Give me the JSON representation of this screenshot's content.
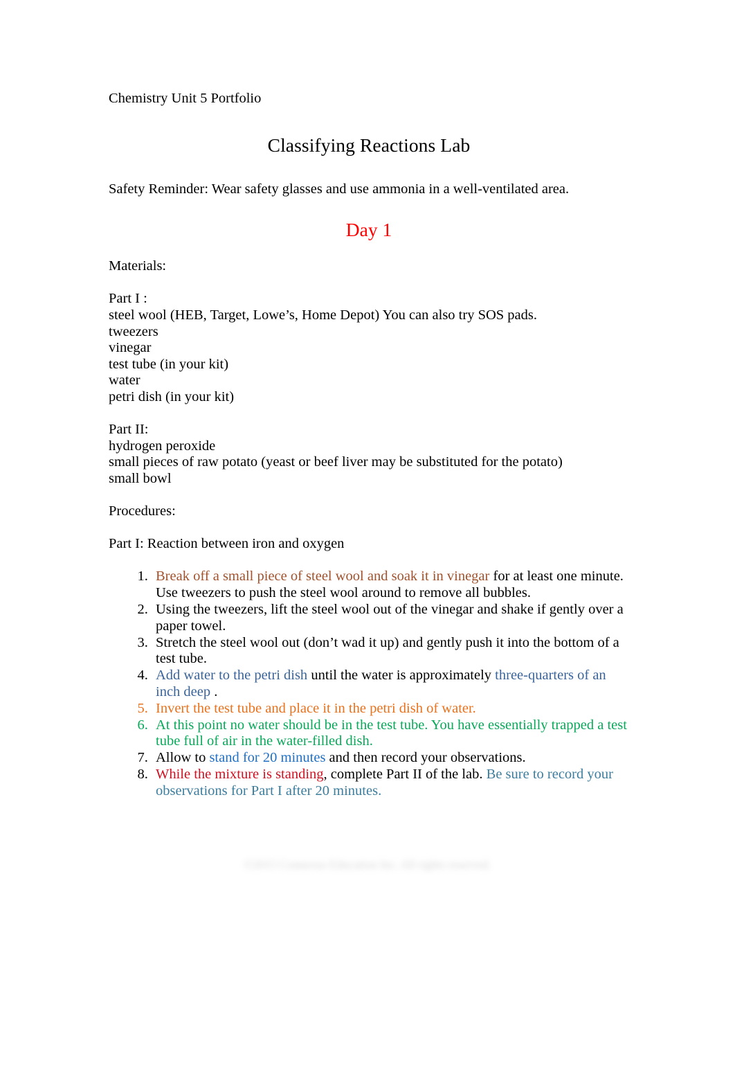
{
  "document": {
    "header_label": "Chemistry Unit 5 Portfolio",
    "title": "Classifying Reactions Lab",
    "safety_reminder": "Safety Reminder: Wear safety glasses and use ammonia in a well-ventilated area.",
    "day_heading": "Day 1",
    "materials_heading": "Materials:",
    "part1_heading": "Part I :",
    "part1_materials": [
      "steel wool (HEB, Target, Lowe’s, Home Depot) You can also try SOS pads.",
      "tweezers",
      "vinegar",
      "test tube (in your kit)",
      "water",
      "petri dish (in your kit)"
    ],
    "part2_heading": "Part II:",
    "part2_materials": [
      "hydrogen peroxide",
      "small pieces of raw potato (yeast or beef liver may be substituted for the potato)",
      "small bowl"
    ],
    "procedures_heading": "Procedures:",
    "part1_procedure_heading": "Part I: Reaction between iron and oxygen",
    "steps": [
      {
        "number": "1.",
        "number_color": "black",
        "runs": [
          {
            "text": "Break off a small piece of steel wool and soak it in vinegar",
            "color": "brown"
          },
          {
            "text": "     for at least one minute. Use tweezers to push the steel wool around to remove all bubbles.",
            "color": "black"
          }
        ]
      },
      {
        "number": "2.",
        "number_color": "black",
        "runs": [
          {
            "text": "Using the tweezers, lift the steel wool out of the vinegar and shake if gently over a paper towel.",
            "color": "black"
          }
        ]
      },
      {
        "number": "3.",
        "number_color": "black",
        "runs": [
          {
            "text": "Stretch the steel wool out (don’t wad it up)   and gently push it into the bottom of a test tube.",
            "color": "black"
          }
        ]
      },
      {
        "number": "4.",
        "number_color": "black",
        "runs": [
          {
            "text": "Add water to the petri dish",
            "color": "blue"
          },
          {
            "text": "    until the water is approximately ",
            "color": "black"
          },
          {
            "text": "three-quarters of an inch deep",
            "color": "blue"
          },
          {
            "text": " .",
            "color": "black"
          }
        ]
      },
      {
        "number": "5.",
        "number_color": "orange",
        "runs": [
          {
            "text": "Invert the test tube and place it in the petri dish of water.",
            "color": "orange"
          }
        ]
      },
      {
        "number": "6.",
        "number_color": "green",
        "runs": [
          {
            "text": "At this point no water should be in the test tube. You have essentially trapped a test tube full of air in the water-filled dish.",
            "color": "green"
          }
        ]
      },
      {
        "number": "7.",
        "number_color": "black",
        "runs": [
          {
            "text": "Allow to ",
            "color": "black"
          },
          {
            "text": "stand for 20 minutes",
            "color": "blue2"
          },
          {
            "text": "   and then record your observations.",
            "color": "black"
          }
        ]
      },
      {
        "number": "8.",
        "number_color": "black",
        "runs": [
          {
            "text": "While the mixture is standing",
            "color": "red"
          },
          {
            "text": ", complete Part II  of the lab. ",
            "color": "black"
          },
          {
            "text": "Be sure to record your observations for Part I after 20 minutes.",
            "color": "teal"
          }
        ]
      }
    ],
    "footer_watermark": "©2015 Connexus Education Inc. All rights reserved."
  },
  "colors": {
    "brown": "#a0522d",
    "orange": "#e8711c",
    "green": "#0aa85a",
    "blue": "#3a6499",
    "blue2": "#1f6fc4",
    "teal": "#3d7d9e",
    "red": "#cc1122",
    "black": "#000000",
    "day_heading_red": "#ff0000"
  }
}
